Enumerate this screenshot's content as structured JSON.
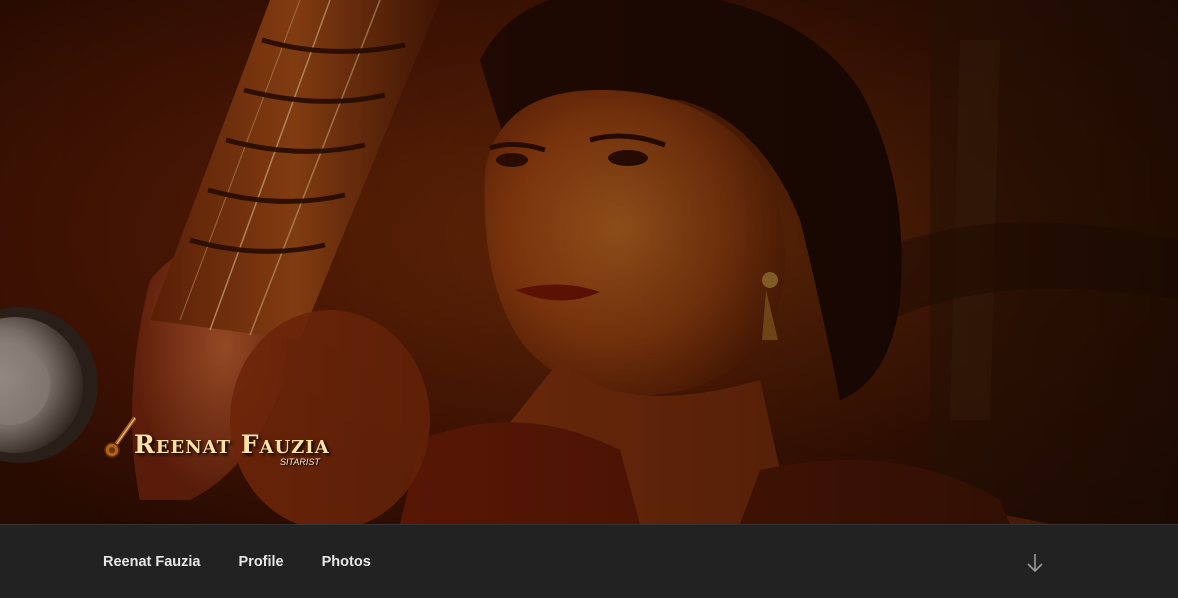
{
  "site": {
    "title": "Reenat Fauzia",
    "tagline": "SITARIST"
  },
  "nav": {
    "items": [
      {
        "label": "Reenat Fauzia"
      },
      {
        "label": "Profile"
      },
      {
        "label": "Photos"
      }
    ],
    "scroll_icon": "arrow-down-icon"
  },
  "colors": {
    "nav_background": "#222222",
    "nav_text": "#e6e6e6",
    "title_text": "#ffe2a6",
    "hero_tone": "#8a2e08"
  }
}
